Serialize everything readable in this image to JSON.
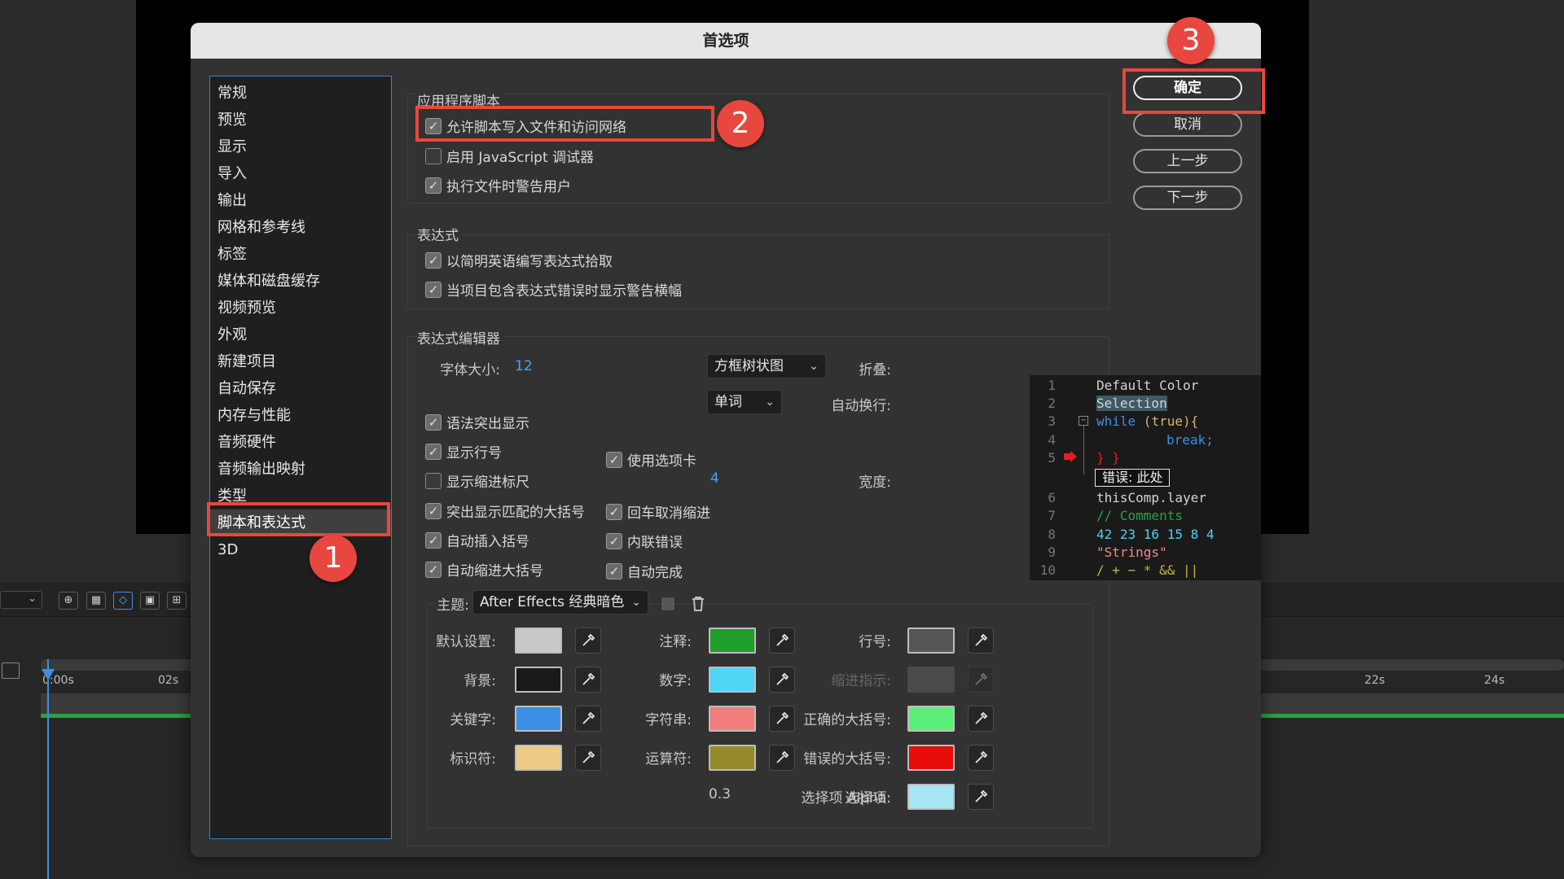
{
  "background": {
    "timeline_labels": [
      "0:00s",
      "02s",
      "22s",
      "24s"
    ],
    "tool_icons": [
      "zoom-icon",
      "transparency-grid-icon",
      "mask-path-icon",
      "region-icon",
      "safe-zone-icon"
    ]
  },
  "dialog": {
    "title": "首选项",
    "categories": [
      {
        "label": "常规"
      },
      {
        "label": "预览"
      },
      {
        "label": "显示"
      },
      {
        "label": "导入"
      },
      {
        "label": "输出"
      },
      {
        "label": "网格和参考线"
      },
      {
        "label": "标签"
      },
      {
        "label": "媒体和磁盘缓存"
      },
      {
        "label": "视频预览"
      },
      {
        "label": "外观"
      },
      {
        "label": "新建项目"
      },
      {
        "label": "自动保存"
      },
      {
        "label": "内存与性能"
      },
      {
        "label": "音频硬件"
      },
      {
        "label": "音频输出映射"
      },
      {
        "label": "类型"
      },
      {
        "label": "脚本和表达式"
      },
      {
        "label": "3D"
      }
    ],
    "selected_category": "脚本和表达式",
    "buttons": {
      "ok": "确定",
      "cancel": "取消",
      "prev": "上一步",
      "next": "下一步"
    },
    "app_scripts": {
      "title": "应用程序脚本",
      "allow_write": {
        "label": "允许脚本写入文件和访问网络",
        "checked": true
      },
      "enable_debugger": {
        "label": "启用 JavaScript 调试器",
        "checked": false
      },
      "warn_user": {
        "label": "执行文件时警告用户",
        "checked": true
      }
    },
    "expressions": {
      "title": "表达式",
      "plain_english": {
        "label": "以简明英语编写表达式拾取",
        "checked": true
      },
      "error_banner": {
        "label": "当项目包含表达式错误时显示警告横幅",
        "checked": true
      }
    },
    "editor": {
      "title": "表达式编辑器",
      "font_size_label": "字体大小:",
      "font_size_value": "12",
      "fold_label": "折叠:",
      "fold_value": "方框树状图",
      "wrap_label": "自动换行:",
      "wrap_value": "单词",
      "syntax_highlight": {
        "label": "语法突出显示",
        "checked": true
      },
      "show_line_numbers": {
        "label": "显示行号",
        "checked": true
      },
      "show_indent_ruler": {
        "label": "显示缩进标尺",
        "checked": false
      },
      "highlight_brackets": {
        "label": "突出显示匹配的大括号",
        "checked": true
      },
      "auto_insert_brackets": {
        "label": "自动插入括号",
        "checked": true
      },
      "auto_indent_braces": {
        "label": "自动缩进大括号",
        "checked": true
      },
      "use_tabs": {
        "label": "使用选项卡",
        "checked": true
      },
      "tab_width_label": "宽度:",
      "tab_width_value": "4",
      "enter_cancel_indent": {
        "label": "回车取消缩进",
        "checked": true
      },
      "inline_errors": {
        "label": "内联错误",
        "checked": true
      },
      "autocomplete": {
        "label": "自动完成",
        "checked": true
      }
    },
    "code_preview": {
      "line_numbers": [
        "1",
        "2",
        "3",
        "4",
        "5",
        "6",
        "7",
        "8",
        "9",
        "10"
      ],
      "line1": "Default Color",
      "line2": "Selection",
      "line3_kw": "while",
      "line3_paren": " (true){",
      "line4": "break;",
      "line5": "} }",
      "error_text": "错误: 此处",
      "line6": "thisComp.layer",
      "line7": "// Comments",
      "line8": "42 23 16 15 8 4",
      "line9": "\"Strings\"",
      "line10": "/ + − * && ||"
    },
    "theme": {
      "label": "主题:",
      "value": "After Effects 经典暗色",
      "colors": [
        {
          "label": "默认设置:",
          "color": "#c8c8c8"
        },
        {
          "label": "背景:",
          "color": "#1a1a1a"
        },
        {
          "label": "关键字:",
          "color": "#3d8fe6"
        },
        {
          "label": "标识符:",
          "color": "#edcb86"
        },
        {
          "label": "注释:",
          "color": "#1f9e2a"
        },
        {
          "label": "数字:",
          "color": "#4fd6f7"
        },
        {
          "label": "字符串:",
          "color": "#f27d7d"
        },
        {
          "label": "运算符:",
          "color": "#948a2a"
        },
        {
          "label": "行号:",
          "color": "#555555"
        },
        {
          "label": "缩进指示:",
          "color": "#4a4a4a"
        },
        {
          "label": "正确的大括号:",
          "color": "#5cf07a"
        },
        {
          "label": "错误的大括号:",
          "color": "#e80c0c"
        },
        {
          "label": "选择项:",
          "color": "#a6e6f5"
        }
      ],
      "alpha_label": "选择项 Alpha:",
      "alpha_value": "0.3"
    }
  },
  "annotations": {
    "badge1": "1",
    "badge2": "2",
    "badge3": "3",
    "highlight_color": "#e8473f"
  }
}
